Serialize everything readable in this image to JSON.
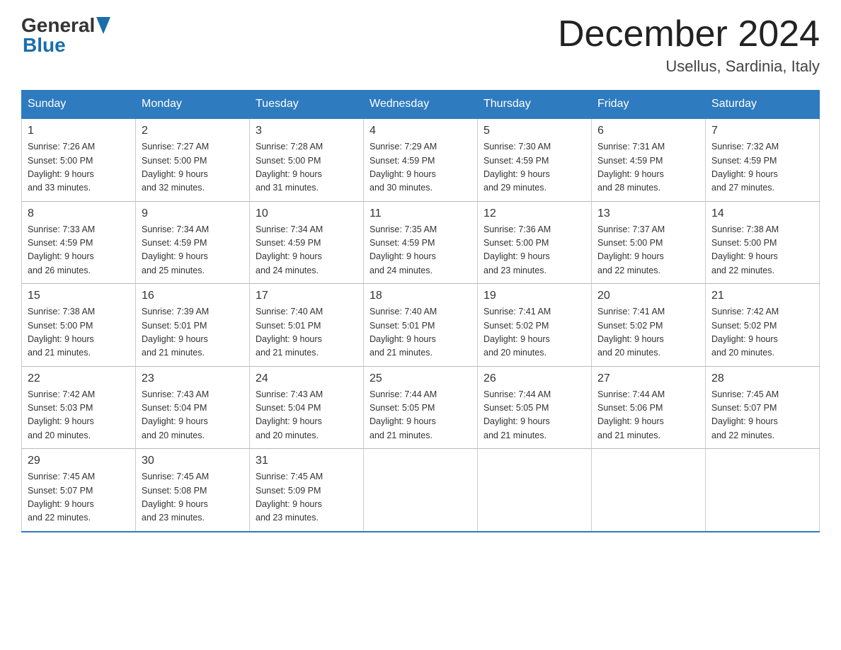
{
  "header": {
    "logo_general": "General",
    "logo_blue": "Blue",
    "month_title": "December 2024",
    "location": "Usellus, Sardinia, Italy"
  },
  "days_of_week": [
    "Sunday",
    "Monday",
    "Tuesday",
    "Wednesday",
    "Thursday",
    "Friday",
    "Saturday"
  ],
  "weeks": [
    [
      {
        "day": "1",
        "sunrise": "Sunrise: 7:26 AM",
        "sunset": "Sunset: 5:00 PM",
        "daylight": "Daylight: 9 hours",
        "daylight2": "and 33 minutes."
      },
      {
        "day": "2",
        "sunrise": "Sunrise: 7:27 AM",
        "sunset": "Sunset: 5:00 PM",
        "daylight": "Daylight: 9 hours",
        "daylight2": "and 32 minutes."
      },
      {
        "day": "3",
        "sunrise": "Sunrise: 7:28 AM",
        "sunset": "Sunset: 5:00 PM",
        "daylight": "Daylight: 9 hours",
        "daylight2": "and 31 minutes."
      },
      {
        "day": "4",
        "sunrise": "Sunrise: 7:29 AM",
        "sunset": "Sunset: 4:59 PM",
        "daylight": "Daylight: 9 hours",
        "daylight2": "and 30 minutes."
      },
      {
        "day": "5",
        "sunrise": "Sunrise: 7:30 AM",
        "sunset": "Sunset: 4:59 PM",
        "daylight": "Daylight: 9 hours",
        "daylight2": "and 29 minutes."
      },
      {
        "day": "6",
        "sunrise": "Sunrise: 7:31 AM",
        "sunset": "Sunset: 4:59 PM",
        "daylight": "Daylight: 9 hours",
        "daylight2": "and 28 minutes."
      },
      {
        "day": "7",
        "sunrise": "Sunrise: 7:32 AM",
        "sunset": "Sunset: 4:59 PM",
        "daylight": "Daylight: 9 hours",
        "daylight2": "and 27 minutes."
      }
    ],
    [
      {
        "day": "8",
        "sunrise": "Sunrise: 7:33 AM",
        "sunset": "Sunset: 4:59 PM",
        "daylight": "Daylight: 9 hours",
        "daylight2": "and 26 minutes."
      },
      {
        "day": "9",
        "sunrise": "Sunrise: 7:34 AM",
        "sunset": "Sunset: 4:59 PM",
        "daylight": "Daylight: 9 hours",
        "daylight2": "and 25 minutes."
      },
      {
        "day": "10",
        "sunrise": "Sunrise: 7:34 AM",
        "sunset": "Sunset: 4:59 PM",
        "daylight": "Daylight: 9 hours",
        "daylight2": "and 24 minutes."
      },
      {
        "day": "11",
        "sunrise": "Sunrise: 7:35 AM",
        "sunset": "Sunset: 4:59 PM",
        "daylight": "Daylight: 9 hours",
        "daylight2": "and 24 minutes."
      },
      {
        "day": "12",
        "sunrise": "Sunrise: 7:36 AM",
        "sunset": "Sunset: 5:00 PM",
        "daylight": "Daylight: 9 hours",
        "daylight2": "and 23 minutes."
      },
      {
        "day": "13",
        "sunrise": "Sunrise: 7:37 AM",
        "sunset": "Sunset: 5:00 PM",
        "daylight": "Daylight: 9 hours",
        "daylight2": "and 22 minutes."
      },
      {
        "day": "14",
        "sunrise": "Sunrise: 7:38 AM",
        "sunset": "Sunset: 5:00 PM",
        "daylight": "Daylight: 9 hours",
        "daylight2": "and 22 minutes."
      }
    ],
    [
      {
        "day": "15",
        "sunrise": "Sunrise: 7:38 AM",
        "sunset": "Sunset: 5:00 PM",
        "daylight": "Daylight: 9 hours",
        "daylight2": "and 21 minutes."
      },
      {
        "day": "16",
        "sunrise": "Sunrise: 7:39 AM",
        "sunset": "Sunset: 5:01 PM",
        "daylight": "Daylight: 9 hours",
        "daylight2": "and 21 minutes."
      },
      {
        "day": "17",
        "sunrise": "Sunrise: 7:40 AM",
        "sunset": "Sunset: 5:01 PM",
        "daylight": "Daylight: 9 hours",
        "daylight2": "and 21 minutes."
      },
      {
        "day": "18",
        "sunrise": "Sunrise: 7:40 AM",
        "sunset": "Sunset: 5:01 PM",
        "daylight": "Daylight: 9 hours",
        "daylight2": "and 21 minutes."
      },
      {
        "day": "19",
        "sunrise": "Sunrise: 7:41 AM",
        "sunset": "Sunset: 5:02 PM",
        "daylight": "Daylight: 9 hours",
        "daylight2": "and 20 minutes."
      },
      {
        "day": "20",
        "sunrise": "Sunrise: 7:41 AM",
        "sunset": "Sunset: 5:02 PM",
        "daylight": "Daylight: 9 hours",
        "daylight2": "and 20 minutes."
      },
      {
        "day": "21",
        "sunrise": "Sunrise: 7:42 AM",
        "sunset": "Sunset: 5:02 PM",
        "daylight": "Daylight: 9 hours",
        "daylight2": "and 20 minutes."
      }
    ],
    [
      {
        "day": "22",
        "sunrise": "Sunrise: 7:42 AM",
        "sunset": "Sunset: 5:03 PM",
        "daylight": "Daylight: 9 hours",
        "daylight2": "and 20 minutes."
      },
      {
        "day": "23",
        "sunrise": "Sunrise: 7:43 AM",
        "sunset": "Sunset: 5:04 PM",
        "daylight": "Daylight: 9 hours",
        "daylight2": "and 20 minutes."
      },
      {
        "day": "24",
        "sunrise": "Sunrise: 7:43 AM",
        "sunset": "Sunset: 5:04 PM",
        "daylight": "Daylight: 9 hours",
        "daylight2": "and 20 minutes."
      },
      {
        "day": "25",
        "sunrise": "Sunrise: 7:44 AM",
        "sunset": "Sunset: 5:05 PM",
        "daylight": "Daylight: 9 hours",
        "daylight2": "and 21 minutes."
      },
      {
        "day": "26",
        "sunrise": "Sunrise: 7:44 AM",
        "sunset": "Sunset: 5:05 PM",
        "daylight": "Daylight: 9 hours",
        "daylight2": "and 21 minutes."
      },
      {
        "day": "27",
        "sunrise": "Sunrise: 7:44 AM",
        "sunset": "Sunset: 5:06 PM",
        "daylight": "Daylight: 9 hours",
        "daylight2": "and 21 minutes."
      },
      {
        "day": "28",
        "sunrise": "Sunrise: 7:45 AM",
        "sunset": "Sunset: 5:07 PM",
        "daylight": "Daylight: 9 hours",
        "daylight2": "and 22 minutes."
      }
    ],
    [
      {
        "day": "29",
        "sunrise": "Sunrise: 7:45 AM",
        "sunset": "Sunset: 5:07 PM",
        "daylight": "Daylight: 9 hours",
        "daylight2": "and 22 minutes."
      },
      {
        "day": "30",
        "sunrise": "Sunrise: 7:45 AM",
        "sunset": "Sunset: 5:08 PM",
        "daylight": "Daylight: 9 hours",
        "daylight2": "and 23 minutes."
      },
      {
        "day": "31",
        "sunrise": "Sunrise: 7:45 AM",
        "sunset": "Sunset: 5:09 PM",
        "daylight": "Daylight: 9 hours",
        "daylight2": "and 23 minutes."
      },
      {
        "day": "",
        "sunrise": "",
        "sunset": "",
        "daylight": "",
        "daylight2": ""
      },
      {
        "day": "",
        "sunrise": "",
        "sunset": "",
        "daylight": "",
        "daylight2": ""
      },
      {
        "day": "",
        "sunrise": "",
        "sunset": "",
        "daylight": "",
        "daylight2": ""
      },
      {
        "day": "",
        "sunrise": "",
        "sunset": "",
        "daylight": "",
        "daylight2": ""
      }
    ]
  ]
}
